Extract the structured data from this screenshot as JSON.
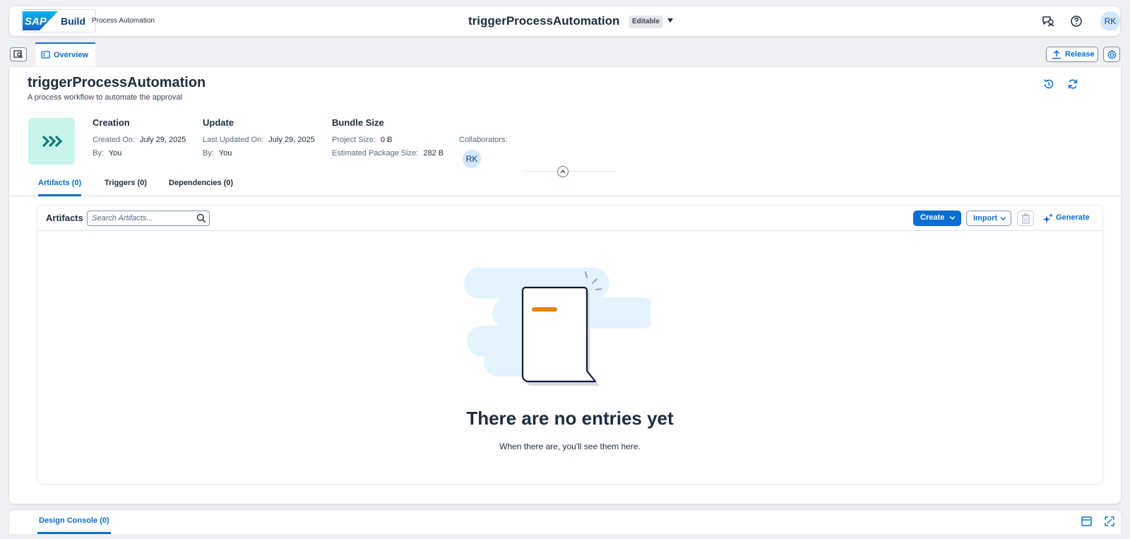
{
  "shell": {
    "logo_text": "SAP",
    "brand": "Build",
    "product": "Process Automation",
    "title": "triggerProcessAutomation",
    "badge": "Editable",
    "user_initials": "RK",
    "icons": [
      "messages-icon",
      "help-icon"
    ]
  },
  "tabs": {
    "overview_label": "Overview",
    "release_label": "Release"
  },
  "project": {
    "title": "triggerProcessAutomation",
    "description": "A process workflow to automate the approval",
    "creation": {
      "heading": "Creation",
      "created_on_label": "Created On:",
      "created_on_value": "July 29, 2025",
      "by_label": "By:",
      "by_value": "You"
    },
    "update": {
      "heading": "Update",
      "updated_on_label": "Last Updated On:",
      "updated_on_value": "July 29, 2025",
      "by_label": "By:",
      "by_value": "You"
    },
    "bundle": {
      "heading": "Bundle Size",
      "project_size_label": "Project Size:",
      "project_size_value": "0 B",
      "package_size_label": "Estimated Package Size:",
      "package_size_value": "282 B"
    },
    "collaborators_label": "Collaborators:",
    "collaborator_initials": "RK",
    "accent_color": "#c8f4ec"
  },
  "subtabs": {
    "artifacts": "Artifacts (0)",
    "triggers": "Triggers (0)",
    "dependencies": "Dependencies (0)"
  },
  "artifacts_panel": {
    "title": "Artifacts",
    "search_placeholder": "Search Artifacts...",
    "create_label": "Create",
    "import_label": "Import",
    "generate_label": "Generate",
    "empty_title": "There are no entries yet",
    "empty_subtitle": "When there are, you'll see them here."
  },
  "console": {
    "tab_label": "Design Console (0)"
  },
  "colors": {
    "accent": "#0a6ed1",
    "text": "#1d2d3e",
    "background": "#eef0f3"
  }
}
